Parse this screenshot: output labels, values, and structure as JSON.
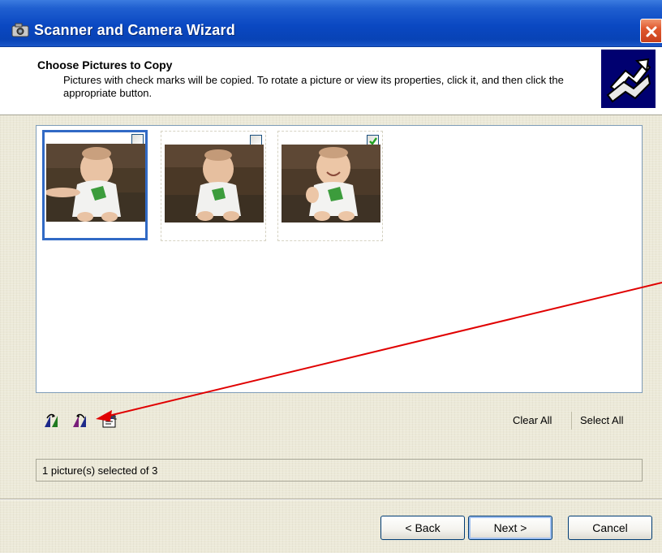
{
  "window": {
    "title": "Scanner and Camera Wizard",
    "icon": "camera-icon",
    "close_icon": "close-icon",
    "colors": {
      "titlebar": "#0a48c2",
      "close": "#e0582e",
      "selection": "#316ac5",
      "annotation_arrow": "#e00000"
    }
  },
  "header": {
    "title": "Choose Pictures to Copy",
    "description": "Pictures with check marks will be copied. To rotate a picture or view its properties, click it, and then click the appropriate button.",
    "logo_icon": "wizard-logo-icon"
  },
  "pictures": [
    {
      "selected_focus": true,
      "checked": false
    },
    {
      "selected_focus": false,
      "checked": false
    },
    {
      "selected_focus": false,
      "checked": true
    }
  ],
  "toolbar": {
    "icons": [
      "rotate-clockwise-icon",
      "rotate-counterclockwise-icon",
      "properties-icon"
    ],
    "clear_all": "Clear All",
    "select_all": "Select All"
  },
  "status": {
    "text": "1 picture(s) selected of 3"
  },
  "buttons": {
    "back": "< Back",
    "next": "Next >",
    "cancel": "Cancel"
  }
}
